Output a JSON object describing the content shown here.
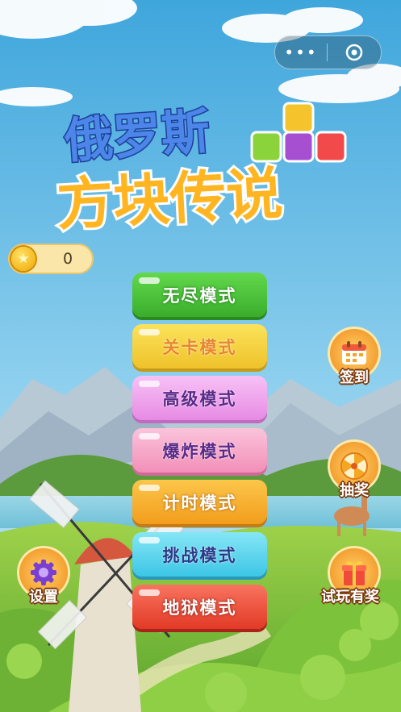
{
  "capsule": {
    "more_label": "•••"
  },
  "title": {
    "line1": "俄罗斯",
    "line2": "方块传说"
  },
  "coins": {
    "value": "0"
  },
  "modes": [
    {
      "label": "无尽模式",
      "color": "#49c43a",
      "text_color": "#ffffff"
    },
    {
      "label": "关卡模式",
      "color": "#f5d442",
      "text_color": "#e8862a"
    },
    {
      "label": "高级模式",
      "color": "#f2a8ef",
      "text_color": "#5a2a88"
    },
    {
      "label": "爆炸模式",
      "color": "#f6a9c8",
      "text_color": "#5a2a88"
    },
    {
      "label": "计时模式",
      "color": "#f7b52f",
      "text_color": "#ffffff"
    },
    {
      "label": "挑战模式",
      "color": "#5fd8ef",
      "text_color": "#2a3a8a"
    },
    {
      "label": "地狱模式",
      "color": "#f04d3a",
      "text_color": "#ffffff"
    }
  ],
  "side": {
    "checkin": "签到",
    "lottery": "抽奖",
    "settings": "设置",
    "trial": "试玩有奖"
  }
}
